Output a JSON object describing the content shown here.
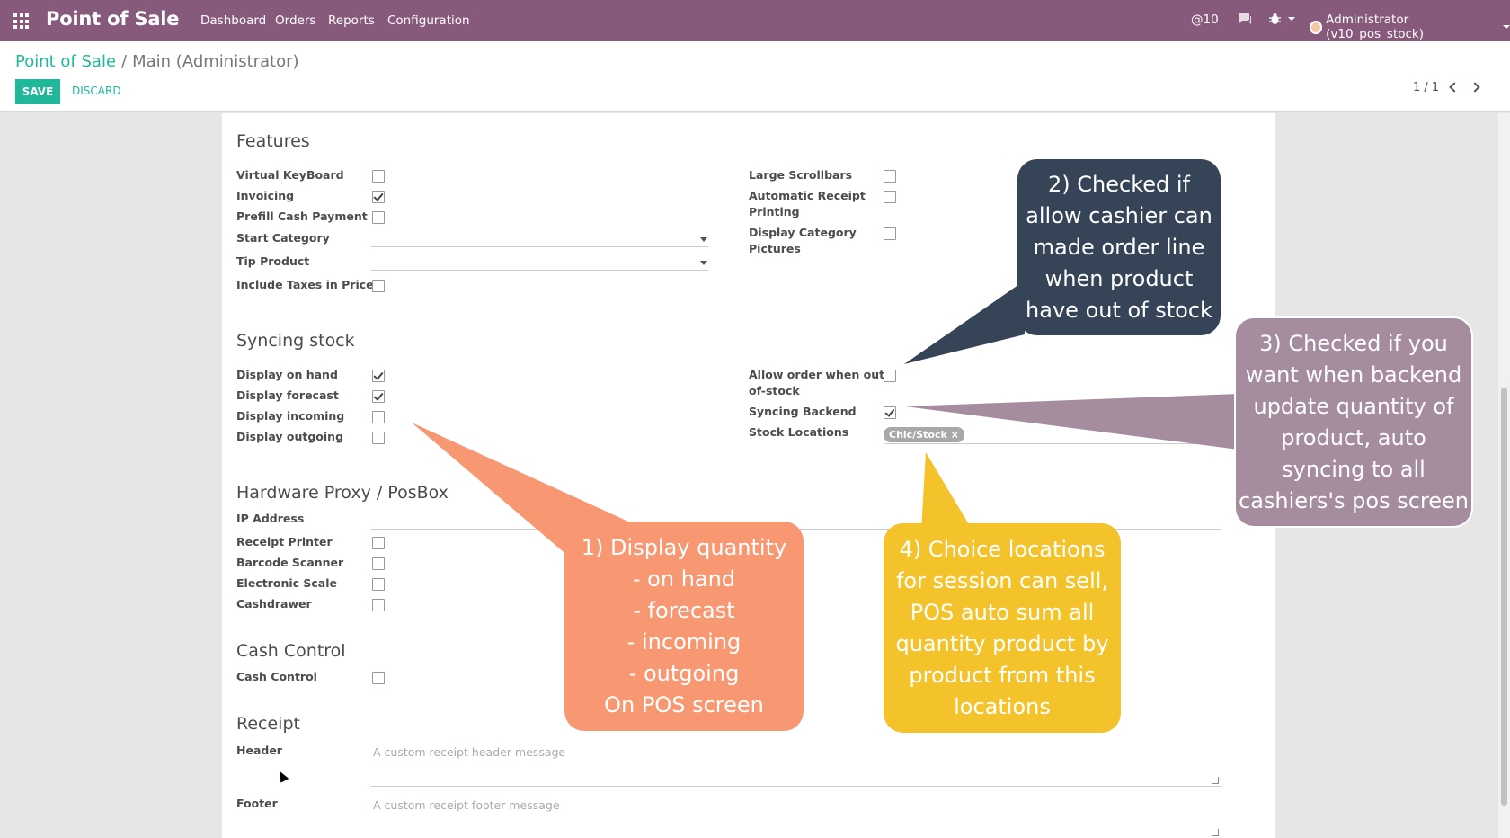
{
  "navbar": {
    "brand": "Point of Sale",
    "menu": [
      "Dashboard",
      "Orders",
      "Reports",
      "Configuration"
    ],
    "mentions": "@10",
    "user": "Administrator (v10_pos_stock)"
  },
  "control": {
    "breadcrumb_root": "Point of Sale",
    "breadcrumb_sep": "/",
    "breadcrumb_current": "Main (Administrator)",
    "save_label": "SAVE",
    "discard_label": "DISCARD",
    "pager": "1 / 1"
  },
  "form": {
    "features": {
      "title": "Features",
      "left": [
        {
          "label": "Virtual KeyBoard",
          "checked": false
        },
        {
          "label": "Invoicing",
          "checked": true
        },
        {
          "label": "Prefill Cash Payment",
          "checked": false
        },
        {
          "label": "Start Category"
        },
        {
          "label": "Tip Product"
        },
        {
          "label": "Include Taxes in Prices",
          "checked": false
        }
      ],
      "right": [
        {
          "label": "Large Scrollbars",
          "checked": false
        },
        {
          "label": "Automatic Receipt\nPrinting",
          "checked": false
        },
        {
          "label": "Display Category\nPictures",
          "checked": false
        }
      ]
    },
    "syncing": {
      "title": "Syncing stock",
      "left": [
        {
          "label": "Display on hand",
          "checked": true
        },
        {
          "label": "Display forecast",
          "checked": true
        },
        {
          "label": "Display incoming",
          "checked": false
        },
        {
          "label": "Display outgoing",
          "checked": false
        }
      ],
      "right": [
        {
          "label": "Allow order when out-\nof-stock",
          "checked": false
        },
        {
          "label": "Syncing Backend",
          "checked": true
        },
        {
          "label": "Stock Locations"
        }
      ],
      "stock_location_tag": "Chic/Stock ×"
    },
    "hardware": {
      "title": "Hardware Proxy / PosBox",
      "ip_label": "IP Address",
      "items": [
        {
          "label": "Receipt Printer",
          "checked": false
        },
        {
          "label": "Barcode Scanner",
          "checked": false
        },
        {
          "label": "Electronic Scale",
          "checked": false
        },
        {
          "label": "Cashdrawer",
          "checked": false
        }
      ]
    },
    "cash": {
      "title": "Cash Control",
      "label": "Cash Control",
      "checked": false
    },
    "receipt": {
      "title": "Receipt",
      "header_label": "Header",
      "header_placeholder": "A custom receipt header message",
      "footer_label": "Footer",
      "footer_placeholder": "A custom receipt footer message"
    }
  },
  "callouts": {
    "c1": "1) Display quantity\n- on hand\n- forecast\n- incoming\n- outgoing\nOn POS screen",
    "c2": "2) Checked if\nallow cashier can\nmade order line\nwhen product\nhave out of stock",
    "c3": "3) Checked if you\nwant when backend\nupdate quantity of\nproduct, auto\nsyncing to all\ncashiers's pos screen",
    "c4": "4) Choice locations\nfor session can sell,\nPOS auto sum all\nquantity product by\nproduct from this\nlocations"
  },
  "colors": {
    "navbar": "#875a7b",
    "accent": "#21b799",
    "callout1": "#f79873",
    "callout2": "#354456",
    "callout3": "#a58c9f",
    "callout4": "#f4c22b"
  }
}
